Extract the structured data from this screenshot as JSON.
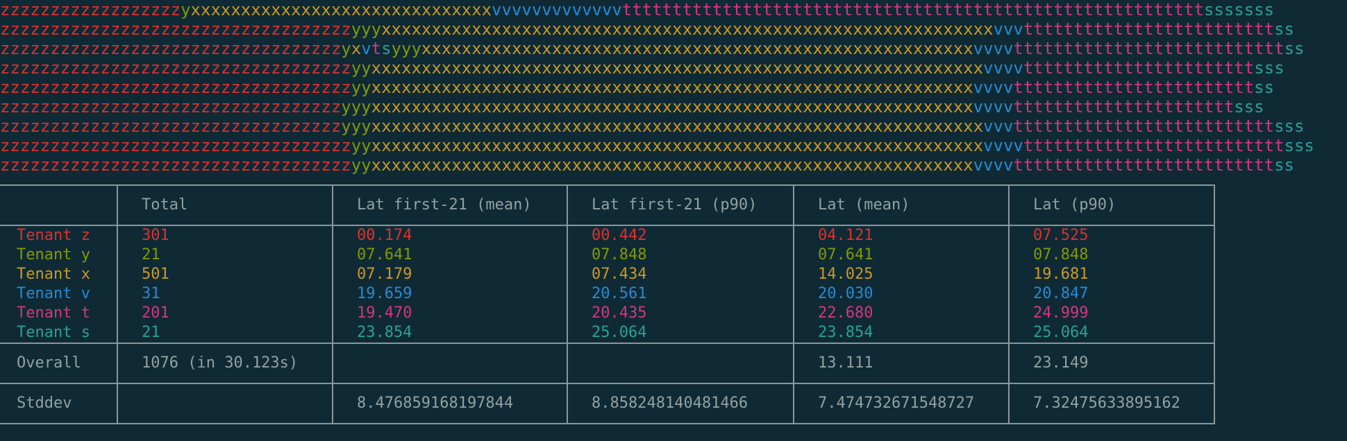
{
  "colors": {
    "z": "#dc322f",
    "y": "#859900",
    "x": "#cb9a23",
    "v": "#268bd2",
    "t": "#d33682",
    "s": "#2aa198",
    "text": "#93a1a1",
    "border": "#8c979b",
    "background": "#0f2a35"
  },
  "timeline": [
    [
      [
        "z",
        "zzzzzzzzzzzzzzzzzz"
      ],
      [
        "y",
        "y"
      ],
      [
        "x",
        "xxxxxxxxxxxxxxxxxxxxxxxxxxxxxx"
      ],
      [
        "v",
        "vvvvvvvvvvvvv"
      ],
      [
        "t",
        "tttttttttttttttttttttttttttttttttttttttttttttttttttttttttt"
      ],
      [
        "s",
        "sssssss"
      ]
    ],
    [
      [
        "z",
        "zzzzzzzzzzzzzzzzzzzzzzzzzzzzzzzzzzz"
      ],
      [
        "y",
        "yyy"
      ],
      [
        "x",
        "xxxxxxxxxxxxxxxxxxxxxxxxxxxxxxxxxxxxxxxxxxxxxxxxxxxxxxxxxxxxx"
      ],
      [
        "v",
        "vvv"
      ],
      [
        "t",
        "ttttttttttttttttttttttttt"
      ],
      [
        "s",
        "ss"
      ]
    ],
    [
      [
        "z",
        "zzzzzzzzzzzzzzzzzzzzzzzzzzzzzzzzzz"
      ],
      [
        "y",
        "y"
      ],
      [
        "x",
        "x"
      ],
      [
        "v",
        "v"
      ],
      [
        "t",
        "t"
      ],
      [
        "s",
        "s"
      ],
      [
        "y",
        "yyy"
      ],
      [
        "x",
        "xxxxxxxxxxxxxxxxxxxxxxxxxxxxxxxxxxxxxxxxxxxxxxxxxxxxxxx"
      ],
      [
        "v",
        "vvvv"
      ],
      [
        "t",
        "ttttttttttttttttttttttttttt"
      ],
      [
        "s",
        "ss"
      ]
    ],
    [
      [
        "z",
        "zzzzzzzzzzzzzzzzzzzzzzzzzzzzzzzzzzz"
      ],
      [
        "y",
        "yy"
      ],
      [
        "x",
        "xxxxxxxxxxxxxxxxxxxxxxxxxxxxxxxxxxxxxxxxxxxxxxxxxxxxxxxxxxxxx"
      ],
      [
        "v",
        "vvvv"
      ],
      [
        "t",
        "ttttttttttttttttttttttt"
      ],
      [
        "s",
        "sss"
      ]
    ],
    [
      [
        "z",
        "zzzzzzzzzzzzzzzzzzzzzzzzzzzzzzzzzzz"
      ],
      [
        "y",
        "yy"
      ],
      [
        "x",
        "xxxxxxxxxxxxxxxxxxxxxxxxxxxxxxxxxxxxxxxxxxxxxxxxxxxxxxxxxxxx"
      ],
      [
        "v",
        "vvvv"
      ],
      [
        "t",
        "tttttttttttttttttttttttt"
      ],
      [
        "s",
        "ss"
      ]
    ],
    [
      [
        "z",
        "zzzzzzzzzzzzzzzzzzzzzzzzzzzzzzzzzz"
      ],
      [
        "y",
        "yyy"
      ],
      [
        "x",
        "xxxxxxxxxxxxxxxxxxxxxxxxxxxxxxxxxxxxxxxxxxxxxxxxxxxxxxxxxxxx"
      ],
      [
        "v",
        "vvvv"
      ],
      [
        "t",
        "tttttttttttttttttttttt"
      ],
      [
        "s",
        "sss"
      ]
    ],
    [
      [
        "z",
        "zzzzzzzzzzzzzzzzzzzzzzzzzzzzzzzzzz"
      ],
      [
        "y",
        "yyy"
      ],
      [
        "x",
        "xxxxxxxxxxxxxxxxxxxxxxxxxxxxxxxxxxxxxxxxxxxxxxxxxxxxxxxxxxxxx"
      ],
      [
        "v",
        "vvv"
      ],
      [
        "t",
        "tttttttttttttttttttttttttt"
      ],
      [
        "s",
        "sss"
      ]
    ],
    [
      [
        "z",
        "zzzzzzzzzzzzzzzzzzzzzzzzzzzzzzzzzzz"
      ],
      [
        "y",
        "yy"
      ],
      [
        "x",
        "xxxxxxxxxxxxxxxxxxxxxxxxxxxxxxxxxxxxxxxxxxxxxxxxxxxxxxxxxxxxx"
      ],
      [
        "v",
        "vvvv"
      ],
      [
        "t",
        "tttttttttttttttttttttttttt"
      ],
      [
        "s",
        "sss"
      ]
    ],
    [
      [
        "z",
        "zzzzzzzzzzzzzzzzzzzzzzzzzzzzzzzzzzz"
      ],
      [
        "y",
        "yy"
      ],
      [
        "x",
        "xxxxxxxxxxxxxxxxxxxxxxxxxxxxxxxxxxxxxxxxxxxxxxxxxxxxxxxxxxxx"
      ],
      [
        "v",
        "vvvv"
      ],
      [
        "t",
        "tttttttttttttttttttttttttt"
      ],
      [
        "s",
        "ss"
      ]
    ]
  ],
  "table": {
    "headers": [
      "",
      "Total",
      "Lat first-21 (mean)",
      "Lat first-21 (p90)",
      "Lat (mean)",
      "Lat (p90)"
    ],
    "tenants": [
      {
        "key": "z",
        "label": "Tenant z",
        "total": "301",
        "first_mean": "00.174",
        "first_p90": "00.442",
        "mean": "04.121",
        "p90": "07.525"
      },
      {
        "key": "y",
        "label": "Tenant y",
        "total": "21",
        "first_mean": "07.641",
        "first_p90": "07.848",
        "mean": "07.641",
        "p90": "07.848"
      },
      {
        "key": "x",
        "label": "Tenant x",
        "total": "501",
        "first_mean": "07.179",
        "first_p90": "07.434",
        "mean": "14.025",
        "p90": "19.681"
      },
      {
        "key": "v",
        "label": "Tenant v",
        "total": "31",
        "first_mean": "19.659",
        "first_p90": "20.561",
        "mean": "20.030",
        "p90": "20.847"
      },
      {
        "key": "t",
        "label": "Tenant t",
        "total": "201",
        "first_mean": "19.470",
        "first_p90": "20.435",
        "mean": "22.680",
        "p90": "24.999"
      },
      {
        "key": "s",
        "label": "Tenant s",
        "total": "21",
        "first_mean": "23.854",
        "first_p90": "25.064",
        "mean": "23.854",
        "p90": "25.064"
      }
    ],
    "overall": {
      "label": "Overall",
      "total": "1076 (in 30.123s)",
      "first_mean": "",
      "first_p90": "",
      "mean": "13.111",
      "p90": "23.149"
    },
    "stddev": {
      "label": "Stddev",
      "total": "",
      "first_mean": "8.476859168197844",
      "first_p90": "8.858248140481466",
      "mean": "7.474732671548727",
      "p90": "7.32475633895162"
    }
  }
}
